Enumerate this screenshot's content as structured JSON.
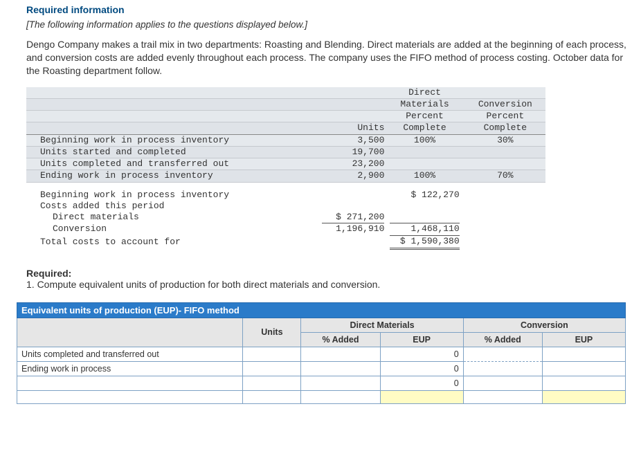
{
  "header": {
    "required_info": "Required information",
    "note": "[The following information applies to the questions displayed below.]",
    "body": "Dengo Company makes a trail mix in two departments: Roasting and Blending. Direct materials are added at the beginning of each process, and conversion costs are added evenly throughout each process. The company uses the FIFO method of process costing. October data for the Roasting department follow."
  },
  "data_table": {
    "col_units": "Units",
    "col_dm_top": "Direct",
    "col_dm_mid": "Materials",
    "col_conv": "Conversion",
    "percent": "Percent",
    "complete": "Complete",
    "rows": {
      "begin_wip": {
        "label": "Beginning work in process inventory",
        "units": "3,500",
        "dm": "100%",
        "conv": "30%"
      },
      "started": {
        "label": "Units started and completed",
        "units": "19,700"
      },
      "completed": {
        "label": "Units completed and transferred out",
        "units": "23,200"
      },
      "end_wip": {
        "label": "Ending work in process inventory",
        "units": "2,900",
        "dm": "100%",
        "conv": "70%"
      }
    },
    "costs": {
      "begin_wip": {
        "label": "Beginning work in process inventory",
        "value": "$ 122,270"
      },
      "added": {
        "label": "Costs added this period"
      },
      "dm": {
        "label": "Direct materials",
        "value": "$ 271,200"
      },
      "conv": {
        "label": "Conversion",
        "value": "1,196,910",
        "sum": "1,468,110"
      },
      "total": {
        "label": "Total costs to account for",
        "value": "$ 1,590,380"
      }
    }
  },
  "required": {
    "hdr": "Required:",
    "q1": "1. Compute equivalent units of production for both direct materials and conversion."
  },
  "entry": {
    "title": "Equivalent units of production (EUP)- FIFO method",
    "units": "Units",
    "dm": "Direct Materials",
    "conv": "Conversion",
    "pct": "% Added",
    "eup": "EUP",
    "row1": "Units completed and transferred out",
    "row2": "Ending work in process",
    "zero": "0"
  }
}
